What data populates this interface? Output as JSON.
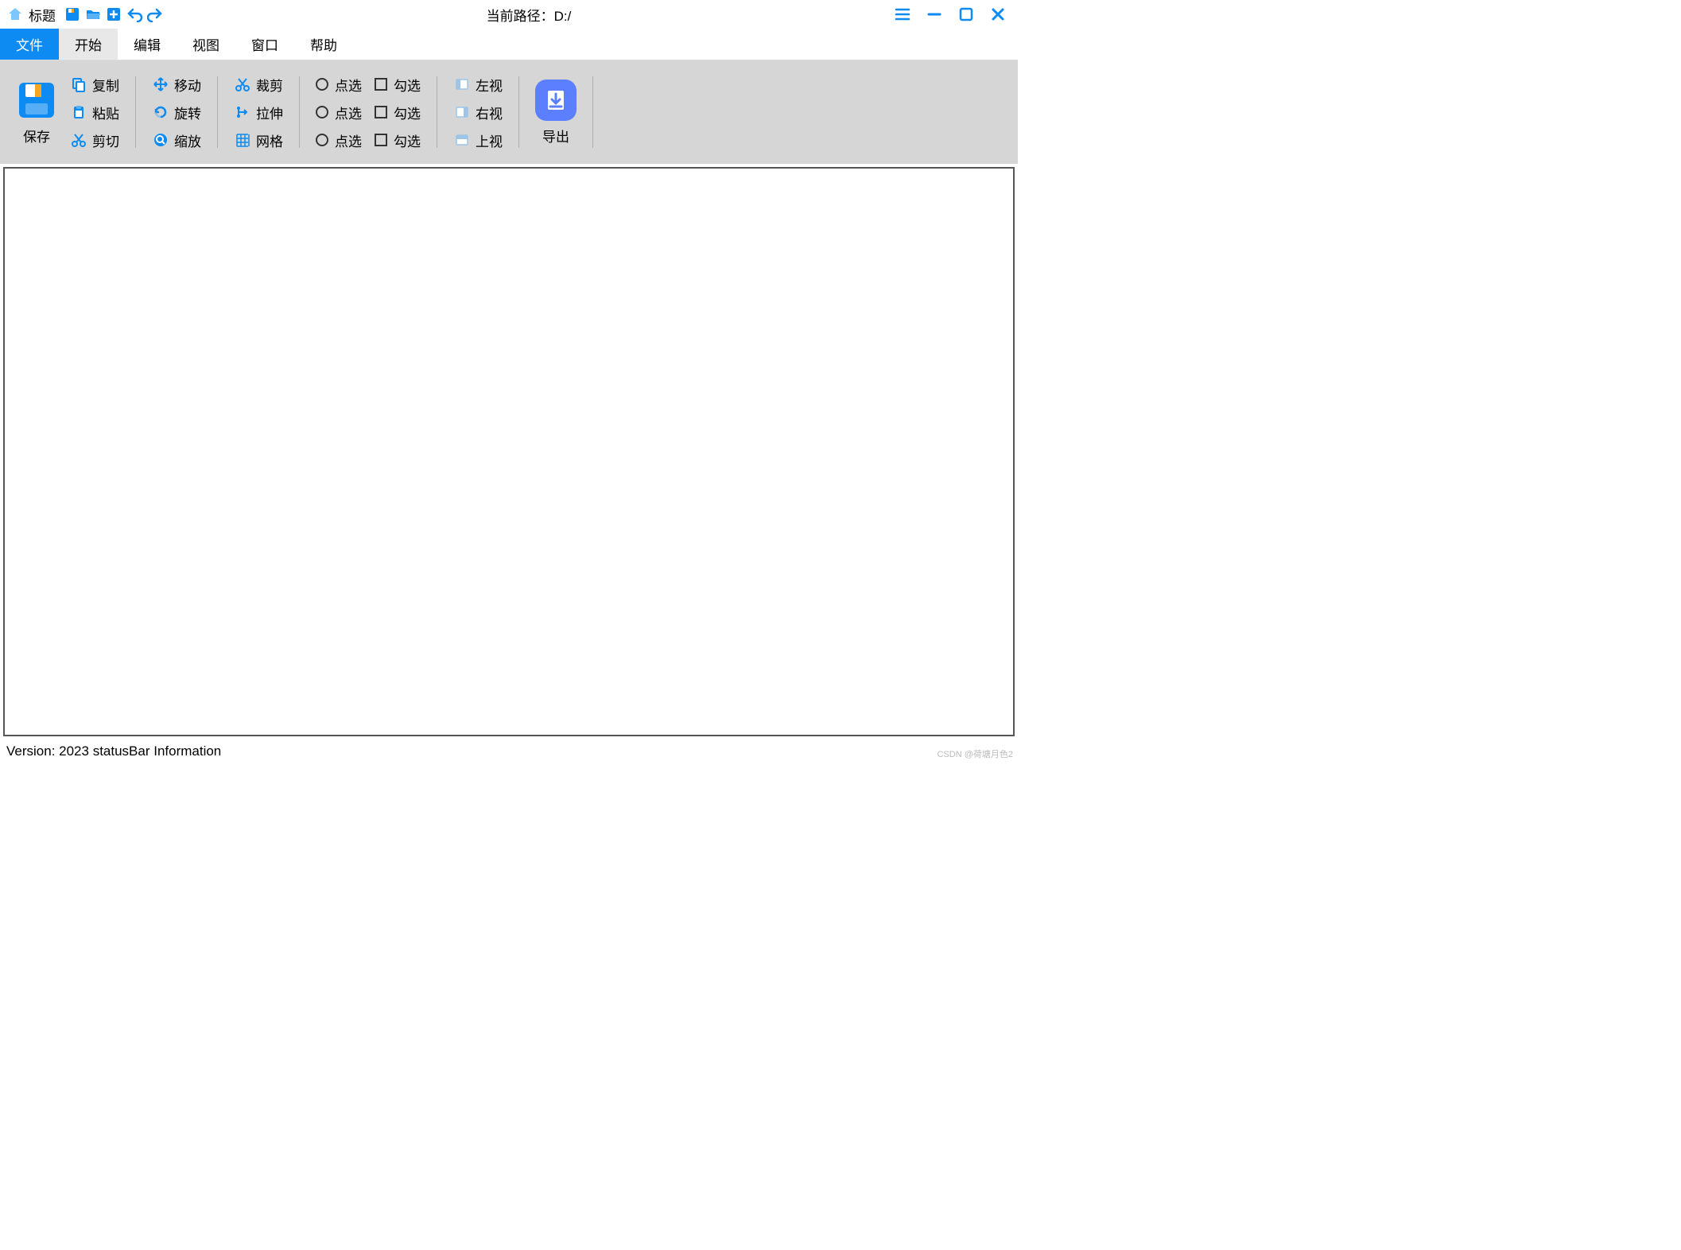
{
  "titlebar": {
    "title": "标题",
    "path_label": "当前路径：D:/"
  },
  "menu": {
    "file": "文件",
    "start": "开始",
    "edit": "编辑",
    "view": "视图",
    "window": "窗口",
    "help": "帮助"
  },
  "ribbon": {
    "save": "保存",
    "copy": "复制",
    "paste": "粘贴",
    "cut": "剪切",
    "move": "移动",
    "rotate": "旋转",
    "scale": "缩放",
    "crop": "裁剪",
    "stretch": "拉伸",
    "grid": "网格",
    "radio1": "点选",
    "radio2": "点选",
    "radio3": "点选",
    "check1": "勾选",
    "check2": "勾选",
    "check3": "勾选",
    "left_view": "左视",
    "right_view": "右视",
    "top_view": "上视",
    "export": "导出"
  },
  "status": {
    "text": "Version: 2023  statusBar Information",
    "watermark": "CSDN @荷塘月色2"
  },
  "colors": {
    "accent": "#0d8bf2",
    "orange": "#f5a623",
    "blue2": "#5b7fff"
  }
}
